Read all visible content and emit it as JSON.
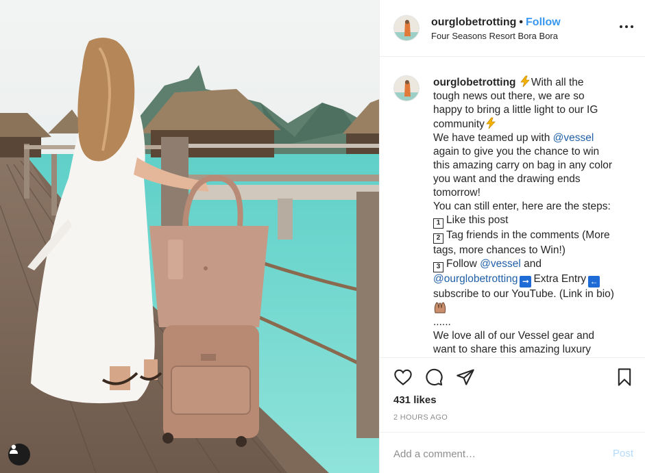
{
  "post": {
    "username": "ourglobetrotting",
    "separator": "•",
    "follow_label": "Follow",
    "location": "Four Seasons Resort Bora Bora",
    "caption_lines": [
      [
        "With all the"
      ],
      [
        "tough news out there, we are so"
      ],
      [
        "happy to bring a little light to our IG"
      ],
      [
        "community"
      ],
      [
        "We have teamed up with ",
        "@vessel"
      ],
      [
        "again to give you the chance to win"
      ],
      [
        "this amazing carry on bag in any color"
      ],
      [
        "you want and the drawing ends"
      ],
      [
        "tomorrow!"
      ],
      [
        "You can still enter, here are the steps:"
      ],
      [
        "1",
        "Like this post"
      ],
      [
        "2",
        "Tag friends in the comments (More"
      ],
      [
        "tags, more chances to Win!)"
      ],
      [
        "3",
        "Follow ",
        "@vessel",
        " and"
      ],
      [
        "@ourglobetrotting",
        "Extra Entry"
      ],
      [
        "subscribe to our YouTube. (Link in bio)"
      ],
      [
        "......"
      ],
      [
        "We love all of our Vessel gear and"
      ],
      [
        "want to share this amazing luxury"
      ]
    ],
    "likes": "431 likes",
    "time_ago": "2 HOURS AGO",
    "comment_placeholder": "Add a comment…",
    "post_label": "Post"
  },
  "icons": {
    "like": "heart-icon",
    "comment": "comment-icon",
    "share": "paper-plane-icon",
    "save": "bookmark-icon",
    "more": "more-options-icon",
    "user_tags": "user-tag-icon",
    "lightning": "lightning-emoji",
    "arrow_right": "right-arrow-emoji",
    "arrow_left": "left-arrow-emoji",
    "raised_hands": "raised-hands-emoji"
  },
  "colors": {
    "follow": "#3897f0",
    "mention": "#1f5fa8",
    "post_disabled": "#b3dbff",
    "muted": "#8e8e8e"
  }
}
